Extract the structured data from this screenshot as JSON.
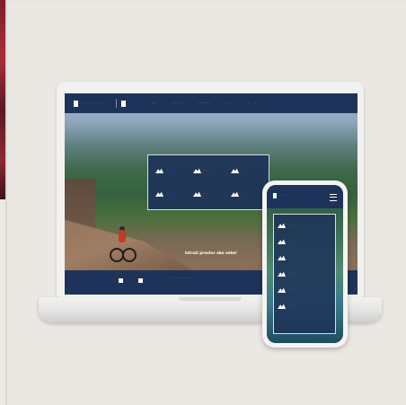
{
  "scene": "Marketing mockup of a tourism cycling website shown on a laptop and a smartphone",
  "laptop": {
    "header": {
      "logo_text": "· · · · · · · · · · · · · ·",
      "nav": [
        "· · ·",
        "· · · · · · ·",
        "· · · · · · ·",
        "· · ·"
      ],
      "lang": [
        "· ·",
        "· ·"
      ]
    },
    "categories": [
      "· · ·",
      "· · ·",
      "· · ·",
      "· · ·",
      "· · ·",
      "· · ·"
    ],
    "tagline": "Istraži prostor oko sebe!",
    "footer": {
      "items": [
        "· · ·",
        "· · ·"
      ],
      "text": "· · · · · · · · · · · · · · · · ·"
    }
  },
  "phone": {
    "logo_text": "· · · · · · · · · ·",
    "items": [
      "· · ·",
      "· · ·",
      "· · ·",
      "· · ·",
      "· · ·",
      "· · ·"
    ]
  },
  "colors": {
    "brand_navy": "#1e3359",
    "background": "#e9e6e2",
    "device_white": "#f1f1f0"
  }
}
